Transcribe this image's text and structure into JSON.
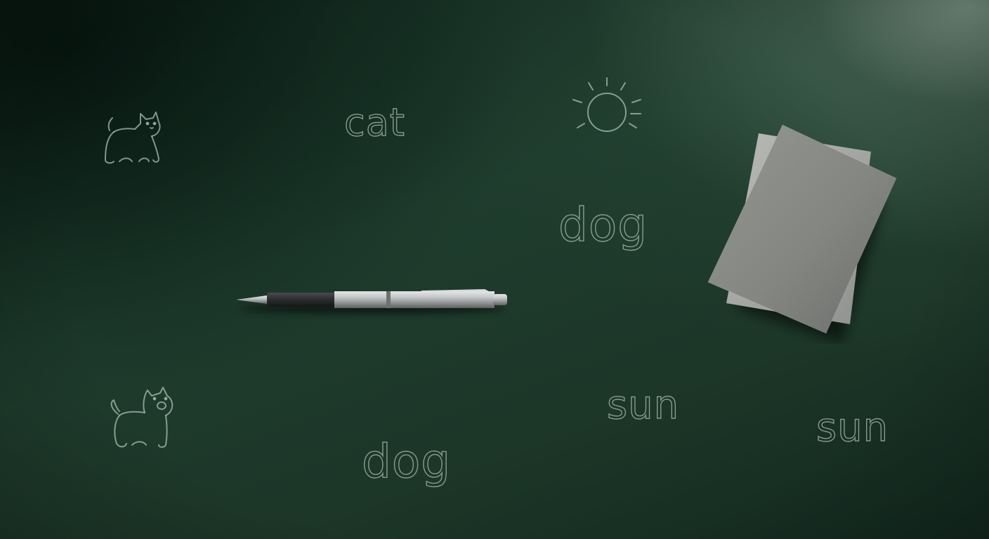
{
  "scene": {
    "description_words": [
      "cat",
      "dog",
      "dog",
      "sun",
      "sun"
    ],
    "colors": {
      "board": "#1f3d2e",
      "chalk_line": "#aabeb2",
      "notebook": "#8a8c89",
      "pen_body": "#b8bbbc",
      "pen_grip": "#2a2b2d"
    }
  },
  "words": {
    "cat": "cat",
    "dog_upper": "dog",
    "dog_lower": "dog",
    "sun_middle": "sun",
    "sun_right": "sun"
  },
  "icons": {
    "cat_top": "cat-doodle-icon",
    "dog_bottom": "dog-doodle-icon",
    "sun": "sun-doodle-icon"
  }
}
